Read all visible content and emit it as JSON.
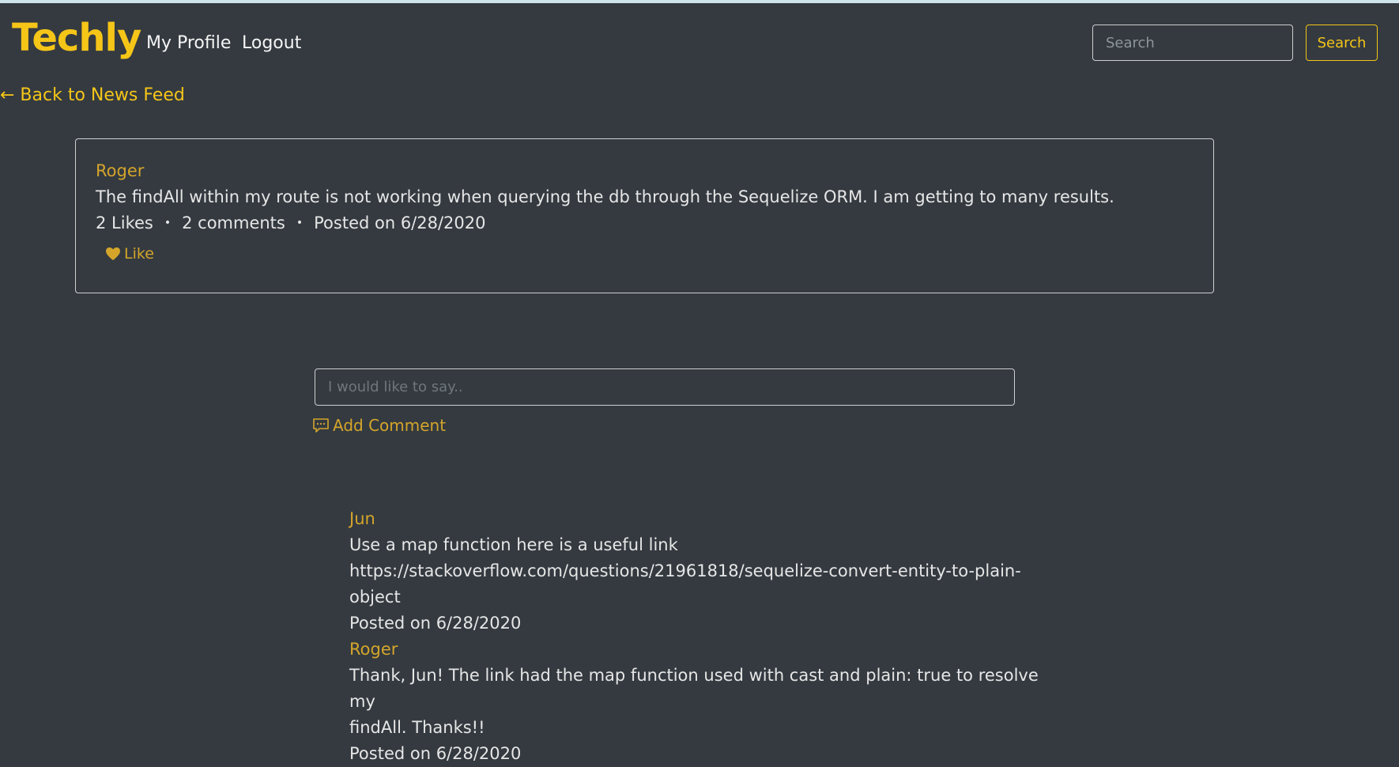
{
  "nav": {
    "brand": "Techly",
    "links": [
      "My Profile",
      "Logout"
    ],
    "search_placeholder": "Search",
    "search_button": "Search"
  },
  "back_link": "← Back to News Feed",
  "post": {
    "author": "Roger",
    "body": "The findAll within my route is not working when querying the db through the Sequelize ORM. I am getting to many results.",
    "likes": "2 Likes",
    "comments_count": "2 comments",
    "posted": "Posted on 6/28/2020",
    "like_label": "Like"
  },
  "comment_form": {
    "placeholder": "I would like to say..",
    "submit_label": "Add Comment"
  },
  "comments": [
    {
      "author": "Jun",
      "lines": [
        "Use a map function here is a useful link",
        "https://stackoverflow.com/questions/21961818/sequelize-convert-entity-to-plain-object"
      ],
      "posted": "Posted on 6/28/2020"
    },
    {
      "author": "Roger",
      "lines": [
        "Thank, Jun! The link had the map function used with cast and plain: true to resolve my",
        "findAll. Thanks!!"
      ],
      "posted": "Posted on 6/28/2020"
    }
  ],
  "colors": {
    "background": "#343a40",
    "accent": "#f5c518",
    "author": "#d4a52a"
  },
  "icons": [
    "heart-icon",
    "comment-icon"
  ]
}
